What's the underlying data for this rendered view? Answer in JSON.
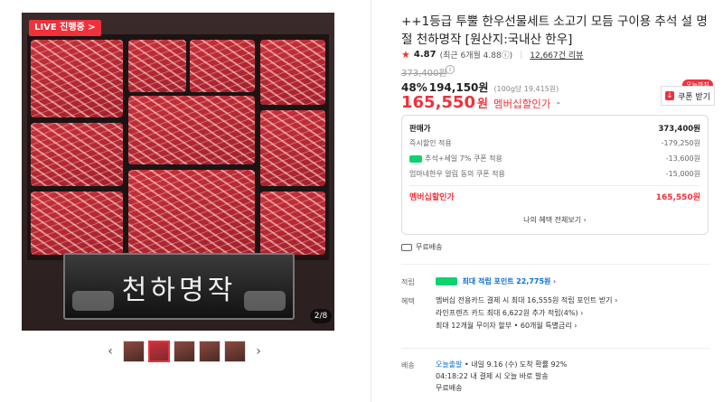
{
  "gallery": {
    "live_badge": "LIVE 진행중 >",
    "plate_text": "천하명작",
    "page_indicator": "2/8",
    "thumb_prev": "‹",
    "thumb_next": "›",
    "thumbnail_count": 5,
    "selected_thumbnail": 2
  },
  "product": {
    "title": "++1등급 투뿔 한우선물세트 소고기 모듬 구이용 추석 설 명절 천하명작 [원산지:국내산 한우]",
    "rating": "4.87",
    "rating_detail": "(최근 6개월 4.88ⓘ)",
    "reviews": "12,667건 리뷰",
    "original_price": "373,400원",
    "discount_rate": "48%",
    "discount_price": "194,150원",
    "unit_price": "(100g당 19,415원)",
    "member_price": "165,550",
    "member_won": "원",
    "member_label": "멤버십할인가",
    "today_tag": "오늘까지",
    "coupon_button": "쿠폰 받기"
  },
  "price_box": {
    "rows": [
      {
        "label": "판매가",
        "value": "373,400원"
      },
      {
        "label": "즉시할인 적용",
        "value": "-179,250원"
      },
      {
        "label": "추석+세일 7% 쿠폰 적용",
        "value": "-13,600원"
      },
      {
        "label": "엄마네한우 알림 동의 쿠폰 적용",
        "value": "-15,000원"
      }
    ],
    "total_label": "멤버십할인가",
    "total_value": "165,550원",
    "more": "나의 혜택 전체보기 ›"
  },
  "shipping_free": "무료배송",
  "details": {
    "points_label": "적립",
    "points_text": "최대 적립 포인트",
    "points_value": "22,775원",
    "benefit_label": "혜택",
    "benefits": [
      "멤버십 전용카드 결제 시 최대 16,555원 적립 포인트 받기 ›",
      "라인프렌즈 카드 최대 6,622원 추가 적립(4%) ›",
      "최대 12개월 무이자 할부 • 60개월 특별금리 ›"
    ],
    "delivery_label": "배송",
    "delivery_today": "오늘출발",
    "delivery_line1": "• 내일 9.16 (수) 도착 확률 92%",
    "delivery_line2": "04:18:22  내 결제 시 오늘 바로 발송",
    "delivery_line3": "무료배송"
  },
  "colors": {
    "accent": "#f0313b",
    "point_blue": "#0a6fd6",
    "naver_green": "#0dd26f"
  }
}
